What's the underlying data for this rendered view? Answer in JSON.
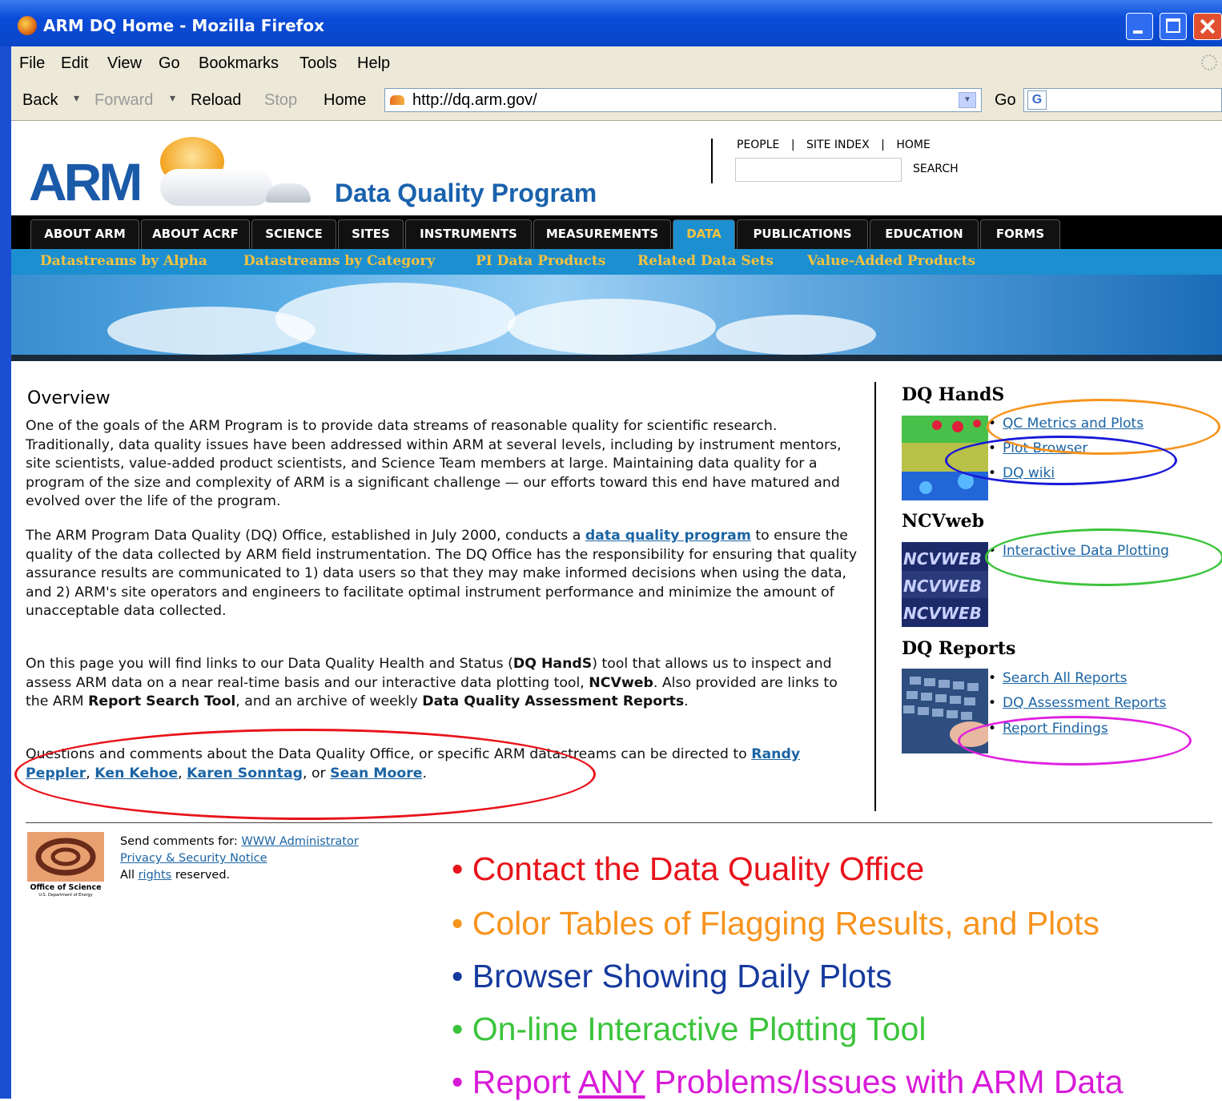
{
  "window": {
    "title": "ARM DQ Home - Mozilla Firefox"
  },
  "menu": [
    "File",
    "Edit",
    "View",
    "Go",
    "Bookmarks",
    "Tools",
    "Help"
  ],
  "nav": {
    "back": "Back",
    "forward": "Forward",
    "reload": "Reload",
    "stop": "Stop",
    "home": "Home",
    "url": "http://dq.arm.gov/",
    "go": "Go"
  },
  "header": {
    "logo": "ARM",
    "program_title": "Data Quality Program",
    "top_links": [
      "PEOPLE",
      "|",
      "SITE INDEX",
      "|",
      "HOME"
    ],
    "search_label": "SEARCH",
    "tabs": [
      "ABOUT ARM",
      "ABOUT ACRF",
      "SCIENCE",
      "SITES",
      "INSTRUMENTS",
      "MEASUREMENTS",
      "DATA",
      "PUBLICATIONS",
      "EDUCATION",
      "FORMS"
    ],
    "active_tab": "DATA",
    "subnav": [
      "Datastreams by Alpha",
      "Datastreams by Category",
      "PI Data Products",
      "Related Data Sets",
      "Value-Added Products"
    ]
  },
  "overview": {
    "title": "Overview",
    "p1": "One of the goals of the ARM Program is to provide data streams of reasonable quality for scientific research. Traditionally, data quality issues have been addressed within ARM at several levels, including by instrument mentors, site scientists, value-added product scientists, and Science Team members at large. Maintaining data quality for a program of the size and complexity of ARM is a significant challenge — our efforts toward this end have matured and evolved over the life of the program.",
    "p2_a": "The ARM Program Data Quality (DQ) Office, established in July 2000, conducts a ",
    "p2_link": "data quality program",
    "p2_b": " to ensure the quality of the data collected by ARM field instrumentation. The DQ Office has the responsibility for ensuring that quality assurance results are communicated to 1) data users so that they may make informed decisions when using the data, and 2) ARM's site operators and engineers to facilitate optimal instrument performance and minimize the amount of unacceptable data collected.",
    "p3_a": "On this page you will find links to our Data Quality Health and Status (",
    "p3_b1": "DQ HandS",
    "p3_c": ") tool that allows us to inspect and assess ARM data on a near real-time basis and our interactive data plotting tool, ",
    "p3_b2": "NCVweb",
    "p3_d": ". Also provided are links to the ARM ",
    "p3_b3": "Report Search Tool",
    "p3_e": ", and an archive of weekly ",
    "p3_b4": "Data Quality Assessment Reports",
    "p3_f": ".",
    "p4_a": "Questions and comments about the Data Quality Office, or specific ARM datastreams can be directed to ",
    "contacts": [
      "Randy Peppler",
      "Ken Kehoe",
      "Karen Sonntag",
      "Sean Moore"
    ],
    "sep1": ", ",
    "sep2": ", ",
    "sep3": ", or ",
    "p4_end": "."
  },
  "sidebar": {
    "hands_title": "DQ HandS",
    "hands_links": [
      "QC Metrics and Plots",
      "Plot Browser",
      "DQ wiki"
    ],
    "ncv_title": "NCVweb",
    "ncv_thumb": "NCVWEB",
    "ncv_links": [
      "Interactive Data Plotting"
    ],
    "reports_title": "DQ Reports",
    "reports_links": [
      "Search All Reports",
      "DQ Assessment Reports",
      "Report Findings"
    ]
  },
  "footer": {
    "send_comments": "Send comments for: ",
    "admin_link": "WWW Administrator",
    "privacy": "Privacy & Security Notice",
    "all": "All ",
    "rights": "rights",
    "reserved": " reserved.",
    "logo_text": "Office of Science",
    "logo_sub": "U.S. Department of Energy"
  },
  "annotations": {
    "bullets": [
      {
        "text": "Contact the Data Quality Office",
        "color": "#e8131b"
      },
      {
        "text": "Color Tables of Flagging Results, and Plots",
        "color": "#f7941d"
      },
      {
        "text": "Browser Showing Daily Plots",
        "color": "#163a9e"
      },
      {
        "text": "On-line Interactive Plotting Tool",
        "color": "#3cc43c"
      },
      {
        "text_a": "Report ",
        "text_u": "ANY",
        "text_b": " Problems/Issues with ARM Data",
        "color": "#d81bd8"
      }
    ],
    "ellipse_colors": {
      "red": "#e8131b",
      "orange": "#f7941d",
      "blue": "#1818d8",
      "green": "#3cc43c",
      "magenta": "#e020e0"
    }
  }
}
